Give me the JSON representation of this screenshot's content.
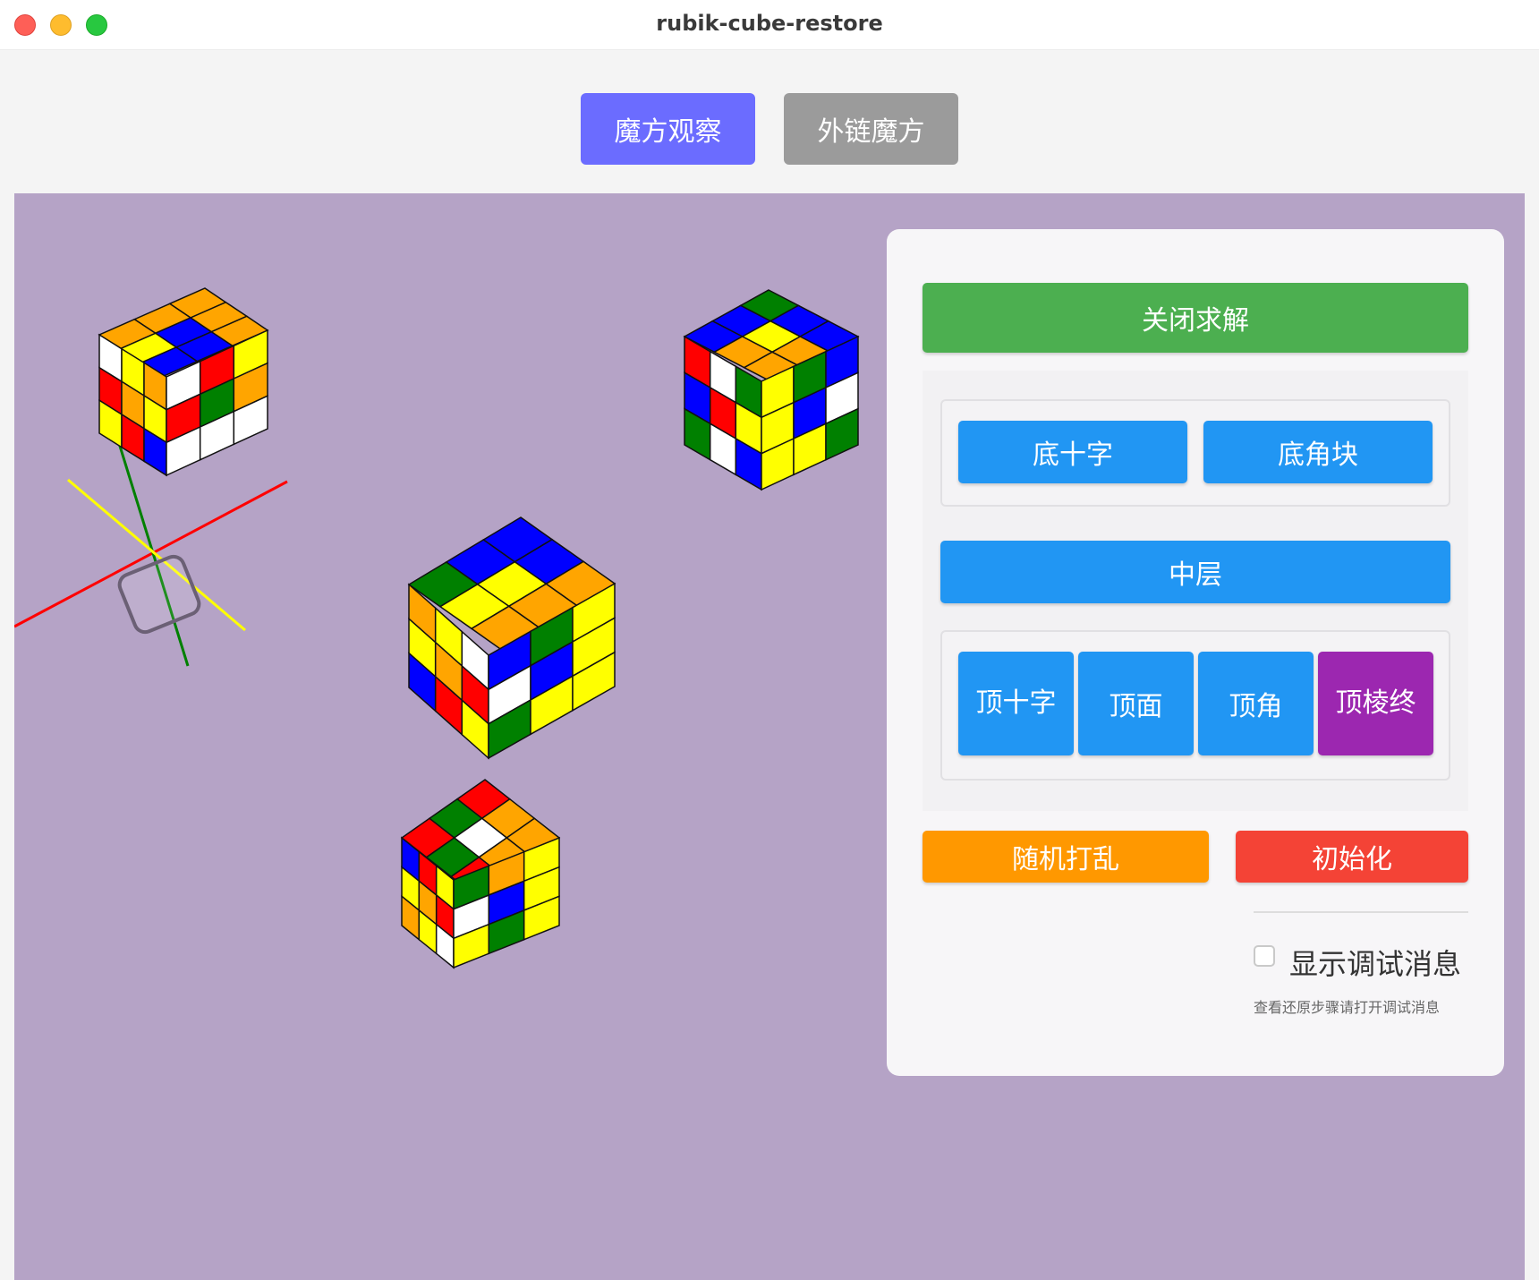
{
  "window": {
    "title": "rubik-cube-restore"
  },
  "tabs": [
    {
      "label": "魔方观察",
      "active": true
    },
    {
      "label": "外链魔方",
      "active": false
    }
  ],
  "panel": {
    "close_solve": "关闭求解",
    "bottom_cross": "底十字",
    "bottom_corners": "底角块",
    "middle_layer": "中层",
    "top_cross": "顶十字",
    "top_face": "顶面",
    "top_corners": "顶角",
    "top_edges": "顶棱终",
    "scramble": "随机打乱",
    "initialize": "初始化",
    "debug_label": "显示调试消息",
    "debug_checked": false,
    "hint": "查看还原步骤请打开调试消息"
  },
  "colors": {
    "stage_bg": "#b5a3c6",
    "tab_active": "#6b6cff",
    "tab_inactive": "#9b9b9b",
    "btn_green": "#4caf50",
    "btn_blue": "#2196f3",
    "btn_purple": "#9c27b0",
    "btn_orange": "#ff9800",
    "btn_red": "#f44336"
  },
  "cubes": [
    {
      "name": "top-left",
      "top": [
        "#ffa500",
        "#ffa500",
        "#ffa500",
        "#ffa500",
        "#0000ff",
        "#0000ff",
        "#ffa500",
        "#ffff00",
        "#0000ff"
      ],
      "left": [
        "#ffffff",
        "#ffff00",
        "#ffa500",
        "#ff0000",
        "#ffa500",
        "#ffff00",
        "#ffff00",
        "#ff0000",
        "#0000ff"
      ],
      "right": [
        "#ffffff",
        "#ff0000",
        "#ffff00",
        "#ff0000",
        "#008000",
        "#ffa500",
        "#ffffff",
        "#ffffff",
        "#ffffff"
      ]
    },
    {
      "name": "top-right",
      "top": [
        "#008000",
        "#0000ff",
        "#0000ff",
        "#0000ff",
        "#ffff00",
        "#ffa500",
        "#0000ff",
        "#ffa500",
        "#ffa500"
      ],
      "left": [
        "#ff0000",
        "#ffffff",
        "#008000",
        "#0000ff",
        "#ff0000",
        "#ffff00",
        "#008000",
        "#ffffff",
        "#0000ff"
      ],
      "right": [
        "#ffff00",
        "#008000",
        "#0000ff",
        "#ffff00",
        "#0000ff",
        "#ffffff",
        "#ffff00",
        "#ffff00",
        "#008000"
      ]
    },
    {
      "name": "center",
      "top": [
        "#0000ff",
        "#0000ff",
        "#ffa500",
        "#0000ff",
        "#ffff00",
        "#ffa500",
        "#008000",
        "#ffff00",
        "#ffa500"
      ],
      "left": [
        "#ffa500",
        "#ffff00",
        "#ffffff",
        "#ffff00",
        "#ffa500",
        "#ff0000",
        "#0000ff",
        "#ff0000",
        "#ffff00"
      ],
      "right": [
        "#0000ff",
        "#008000",
        "#ffff00",
        "#ffffff",
        "#0000ff",
        "#ffff00",
        "#008000",
        "#ffff00",
        "#ffff00"
      ]
    },
    {
      "name": "bottom",
      "top": [
        "#ff0000",
        "#ffa500",
        "#ffa500",
        "#008000",
        "#ffffff",
        "#ffa500",
        "#ff0000",
        "#008000",
        "#ff0000"
      ],
      "left": [
        "#0000ff",
        "#ff0000",
        "#ffff00",
        "#ffff00",
        "#ffa500",
        "#ff0000",
        "#ffa500",
        "#ffff00",
        "#ffffff"
      ],
      "right": [
        "#008000",
        "#ffa500",
        "#ffff00",
        "#ffffff",
        "#0000ff",
        "#ffff00",
        "#ffff00",
        "#008000",
        "#ffff00"
      ]
    }
  ],
  "axes": [
    {
      "name": "x-axis",
      "color": "#ff0000"
    },
    {
      "name": "y-axis",
      "color": "#008000"
    },
    {
      "name": "z-axis",
      "color": "#ffff00"
    }
  ]
}
